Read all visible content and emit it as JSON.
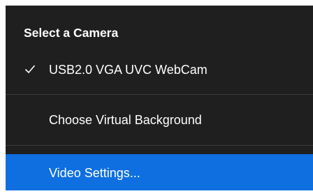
{
  "menu": {
    "section_title": "Select a Camera",
    "camera_item": {
      "label": "USB2.0 VGA UVC WebCam",
      "checked": true,
      "icon": "check-icon"
    },
    "virtual_background_label": "Choose Virtual Background",
    "video_settings_label": "Video Settings...",
    "colors": {
      "menu_background": "#1f1f1f",
      "text": "#ffffff",
      "highlight": "#0f6fe0",
      "divider": "#3a3a3a"
    }
  }
}
